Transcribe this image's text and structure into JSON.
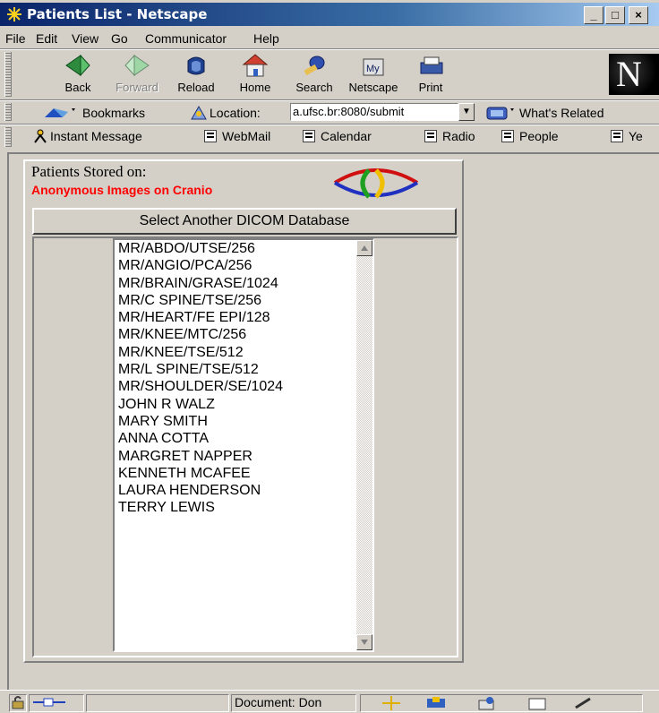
{
  "window": {
    "title": "Patients List - Netscape",
    "min": "_",
    "max": "□",
    "close": "×"
  },
  "menu": [
    "File",
    "Edit",
    "View",
    "Go",
    "Communicator",
    "Help"
  ],
  "nav_buttons": [
    {
      "label": "Back",
      "icon": "back-arrow-icon"
    },
    {
      "label": "Forward",
      "icon": "forward-arrow-icon"
    },
    {
      "label": "Reload",
      "icon": "reload-icon"
    },
    {
      "label": "Home",
      "icon": "home-icon"
    },
    {
      "label": "Search",
      "icon": "search-icon"
    },
    {
      "label": "Netscape",
      "icon": "my-netscape-icon"
    },
    {
      "label": "Print",
      "icon": "print-icon"
    }
  ],
  "logo_letter": "N",
  "location": {
    "bookmarks_label": "Bookmarks",
    "location_label": "Location:",
    "url": "a.ufsc.br:8080/submit",
    "related_label": "What's Related"
  },
  "personal_toolbar": [
    "Instant Message",
    "WebMail",
    "Calendar",
    "Radio",
    "People",
    "Ye"
  ],
  "page": {
    "patients_stored_label": "Patients Stored on:",
    "database_name": "Anonymous Images on Cranio",
    "select_button": "Select Another DICOM Database",
    "patients": [
      "MR/ABDO/UTSE/256",
      "MR/ANGIO/PCA/256",
      "MR/BRAIN/GRASE/1024",
      "MR/C SPINE/TSE/256",
      "MR/HEART/FE EPI/128",
      "MR/KNEE/MTC/256",
      "MR/KNEE/TSE/512",
      "MR/L SPINE/TSE/512",
      "MR/SHOULDER/SE/1024",
      "JOHN R WALZ",
      "MARY SMITH",
      "ANNA COTTA",
      "MARGRET NAPPER",
      "KENNETH MCAFEE",
      "LAURA HENDERSON",
      "TERRY LEWIS"
    ]
  },
  "status": {
    "text": "Document: Don"
  },
  "colors": {
    "title_bar": "#0a246a",
    "chrome": "#d4d0c8",
    "db_name": "#ff0000"
  }
}
